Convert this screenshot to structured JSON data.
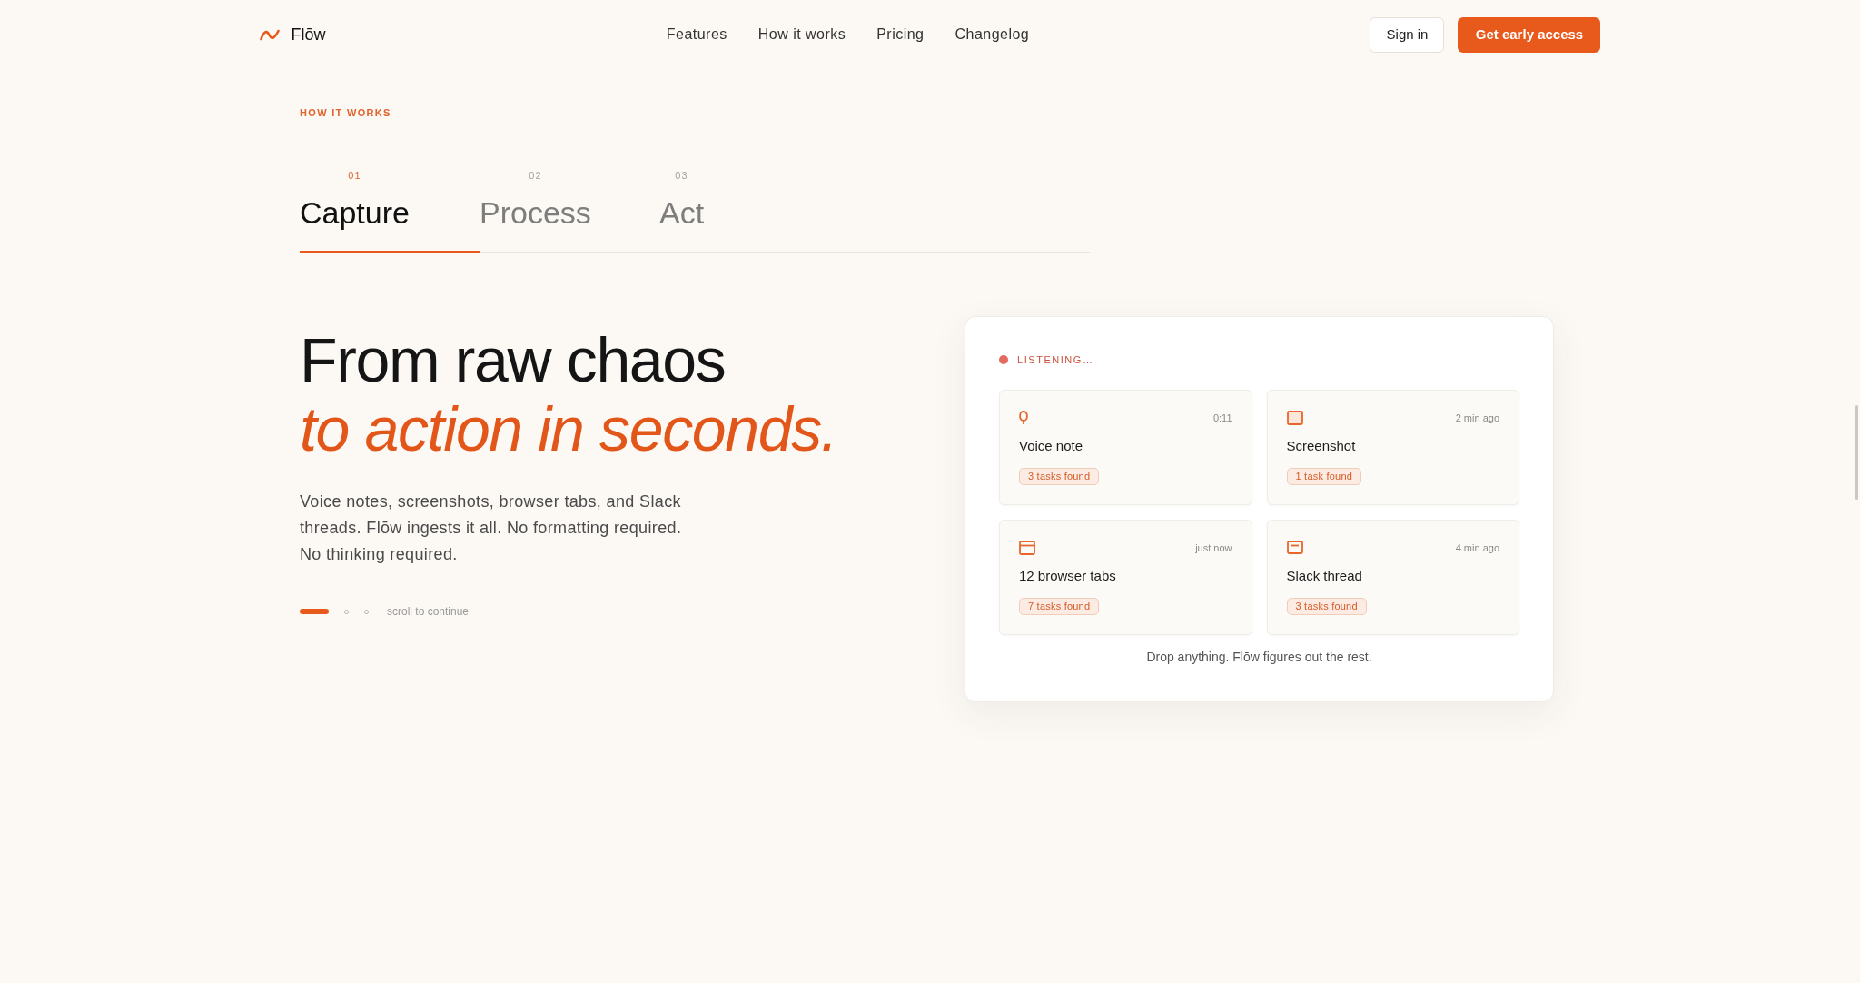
{
  "nav": {
    "logo": "Flōw",
    "links": [
      "Features",
      "How it works",
      "Pricing",
      "Changelog"
    ],
    "sign_in": "Sign in",
    "cta": "Get early access"
  },
  "steps": {
    "eyebrow": "HOW IT WORKS",
    "tabs": [
      {
        "number": "01",
        "label": "Capture",
        "selected": true
      },
      {
        "number": "02",
        "label": "Process",
        "selected": false
      },
      {
        "number": "03",
        "label": "Act",
        "selected": false
      }
    ]
  },
  "hero": {
    "title": "From raw chaos",
    "title_accent": "to action in seconds.",
    "body": "Voice notes, screenshots, browser tabs, and Slack threads. Flōw ingests it all. No formatting required. No thinking required.",
    "pager": [
      {
        "selected": true
      },
      {
        "selected": false
      },
      {
        "selected": false
      }
    ],
    "hint": "scroll to continue"
  },
  "capture_card": {
    "status": "LISTENING…",
    "items": [
      {
        "kind": "voice",
        "title": "Voice note",
        "time": "0:11",
        "badge": "3 tasks found"
      },
      {
        "kind": "screenshot",
        "title": "Screenshot",
        "time": "2 min ago",
        "badge": "1 task found"
      },
      {
        "kind": "browser",
        "title": "12 browser tabs",
        "time": "just now",
        "badge": "7 tasks found"
      },
      {
        "kind": "chat",
        "title": "Slack thread",
        "time": "4 min ago",
        "badge": "3 tasks found"
      }
    ],
    "footer": "Drop anything. Flōw figures out the rest."
  }
}
